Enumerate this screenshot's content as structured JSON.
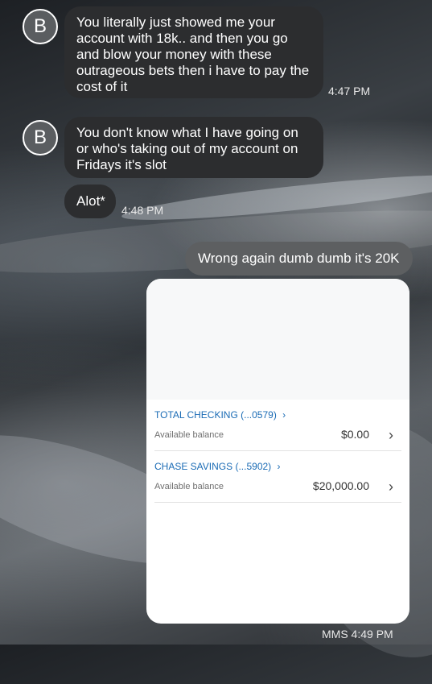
{
  "messages": [
    {
      "avatar": "B",
      "text": "You literally just showed me your account with 18k.. and then you go and blow your money with these outrageous bets then i have to pay the cost of it",
      "time": "4:47 PM"
    },
    {
      "avatar": "B",
      "text": "You don't know what I have going on or who's taking out of my account on Fridays it's slot"
    },
    {
      "text": "Alot*",
      "time": "4:48 PM"
    }
  ],
  "sent": {
    "text": "Wrong again dumb dumb it's 20K",
    "footer": "MMS 4:49 PM"
  },
  "attachment": {
    "accounts": [
      {
        "name": "TOTAL CHECKING (...0579)",
        "chevron": "›",
        "label": "Available balance",
        "amount": "$0.00",
        "row_chevron": "›"
      },
      {
        "name": "CHASE SAVINGS (...5902)",
        "chevron": "›",
        "label": "Available balance",
        "amount": "$20,000.00",
        "row_chevron": "›"
      }
    ]
  }
}
